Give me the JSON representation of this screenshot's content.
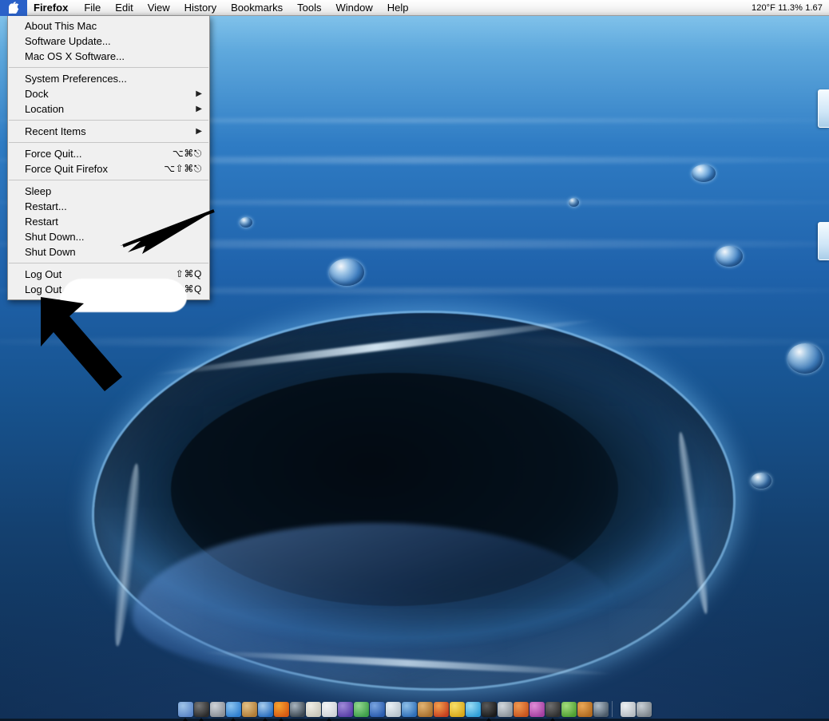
{
  "menubar": {
    "apple_icon": "apple-logo-icon",
    "app_name": "Firefox",
    "items": [
      {
        "label": "File"
      },
      {
        "label": "Edit"
      },
      {
        "label": "View"
      },
      {
        "label": "History"
      },
      {
        "label": "Bookmarks"
      },
      {
        "label": "Tools"
      },
      {
        "label": "Window"
      },
      {
        "label": "Help"
      }
    ],
    "status": "120°F 11.3% 1.67"
  },
  "apple_menu": {
    "groups": [
      {
        "items": [
          {
            "label": "About This Mac",
            "shortcut": "",
            "submenu": false
          },
          {
            "label": "Software Update...",
            "shortcut": "",
            "submenu": false
          },
          {
            "label": "Mac OS X Software...",
            "shortcut": "",
            "submenu": false
          }
        ]
      },
      {
        "items": [
          {
            "label": "System Preferences...",
            "shortcut": "",
            "submenu": false
          },
          {
            "label": "Dock",
            "shortcut": "",
            "submenu": true
          },
          {
            "label": "Location",
            "shortcut": "",
            "submenu": true
          }
        ]
      },
      {
        "items": [
          {
            "label": "Recent Items",
            "shortcut": "",
            "submenu": true
          }
        ]
      },
      {
        "items": [
          {
            "label": "Force Quit...",
            "shortcut": "⌥⌘⎋",
            "submenu": false
          },
          {
            "label": "Force Quit Firefox",
            "shortcut": "⌥⇧⌘⎋",
            "submenu": false
          }
        ]
      },
      {
        "items": [
          {
            "label": "Sleep",
            "shortcut": "",
            "submenu": false
          },
          {
            "label": "Restart...",
            "shortcut": "",
            "submenu": false
          },
          {
            "label": "Restart",
            "shortcut": "",
            "submenu": false
          },
          {
            "label": "Shut Down...",
            "shortcut": "",
            "submenu": false
          },
          {
            "label": "Shut Down",
            "shortcut": "",
            "submenu": false
          }
        ]
      },
      {
        "items": [
          {
            "label": "Log Out",
            "shortcut": "⇧⌘Q",
            "submenu": false
          },
          {
            "label": "Log Out",
            "shortcut": "⌥⇧⌘Q",
            "submenu": false
          }
        ]
      }
    ]
  },
  "annotations": [
    {
      "name": "arrow-pointing-to-shut-down",
      "target": "Shut Down..."
    },
    {
      "name": "arrow-pointing-to-log-out",
      "target": "Log Out"
    },
    {
      "name": "redaction-blob",
      "target": "user name after Log Out"
    }
  ],
  "dock": {
    "icons": [
      {
        "name": "dock-icon-finder",
        "colors": [
          "#5b86c8",
          "#9fc4e8"
        ],
        "running": true
      },
      {
        "name": "dock-icon-dvd-player",
        "colors": [
          "#2a2a2a",
          "#777777"
        ],
        "running": true
      },
      {
        "name": "dock-icon-system-prefs",
        "colors": [
          "#8a8f96",
          "#cfd4da"
        ],
        "running": false
      },
      {
        "name": "dock-icon-chat",
        "colors": [
          "#2f7fd0",
          "#8cc4ef"
        ],
        "running": true
      },
      {
        "name": "dock-icon-address-book",
        "colors": [
          "#b07c36",
          "#e3c187"
        ],
        "running": false
      },
      {
        "name": "dock-icon-safari",
        "colors": [
          "#2a6fc0",
          "#a8cdee"
        ],
        "running": true
      },
      {
        "name": "dock-icon-firefox",
        "colors": [
          "#d85a12",
          "#f5a431"
        ],
        "running": true
      },
      {
        "name": "dock-icon-utility",
        "colors": [
          "#3a4650",
          "#a9b5c0"
        ],
        "running": false
      },
      {
        "name": "dock-icon-notes",
        "colors": [
          "#c9c7bb",
          "#efeee6"
        ],
        "running": false
      },
      {
        "name": "dock-icon-mail",
        "colors": [
          "#cfd3d8",
          "#f3f5f7"
        ],
        "running": true
      },
      {
        "name": "dock-icon-internet-explorer",
        "colors": [
          "#5a3fa8",
          "#9f8ad8"
        ],
        "running": false
      },
      {
        "name": "dock-icon-itunes",
        "colors": [
          "#3f9f4a",
          "#93d98f"
        ],
        "running": false
      },
      {
        "name": "dock-icon-word",
        "colors": [
          "#2a5cad",
          "#7aa5e0"
        ],
        "running": false
      },
      {
        "name": "dock-icon-preview",
        "colors": [
          "#b9c5ce",
          "#e9f0f5"
        ],
        "running": false
      },
      {
        "name": "dock-icon-sherlock",
        "colors": [
          "#2f6fb8",
          "#8fc0e8"
        ],
        "running": false
      },
      {
        "name": "dock-icon-photo-app",
        "colors": [
          "#a8702e",
          "#e2b473"
        ],
        "running": false
      },
      {
        "name": "dock-icon-ms-office",
        "colors": [
          "#c6401f",
          "#f2a14e"
        ],
        "running": false
      },
      {
        "name": "dock-icon-smiley",
        "colors": [
          "#d8a81a",
          "#f8e06a"
        ],
        "running": false
      },
      {
        "name": "dock-icon-skype",
        "colors": [
          "#2f9fd8",
          "#9adcf5"
        ],
        "running": false
      },
      {
        "name": "dock-icon-terminal",
        "colors": [
          "#1a1a1a",
          "#5a5a5a"
        ],
        "running": true
      },
      {
        "name": "dock-icon-printer-setup",
        "colors": [
          "#8d949b",
          "#d2d8dd"
        ],
        "running": false
      },
      {
        "name": "dock-icon-help-viewer",
        "colors": [
          "#c9551e",
          "#f09a52"
        ],
        "running": false
      },
      {
        "name": "dock-icon-paint",
        "colors": [
          "#a33fa0",
          "#e08ed8"
        ],
        "running": false
      },
      {
        "name": "dock-icon-display",
        "colors": [
          "#2f2f2f",
          "#6f6f6f"
        ],
        "running": true
      },
      {
        "name": "dock-icon-battery",
        "colors": [
          "#4f9f32",
          "#a4dd7e"
        ],
        "running": false
      },
      {
        "name": "dock-icon-tools",
        "colors": [
          "#b06a20",
          "#eaa857"
        ],
        "running": false
      },
      {
        "name": "dock-icon-network",
        "colors": [
          "#4b5a68",
          "#aebcc8"
        ],
        "running": false
      },
      {
        "name": "dock-icon-lamp",
        "colors": [
          "#b6bcc2",
          "#edf1f4"
        ],
        "running": false
      },
      {
        "name": "dock-icon-trash",
        "colors": [
          "#7d858c",
          "#c9d0d6"
        ],
        "running": false
      }
    ]
  },
  "desktop": {
    "wallpaper_name": "aqua-water-splash",
    "background_color": "#1f62ab"
  }
}
